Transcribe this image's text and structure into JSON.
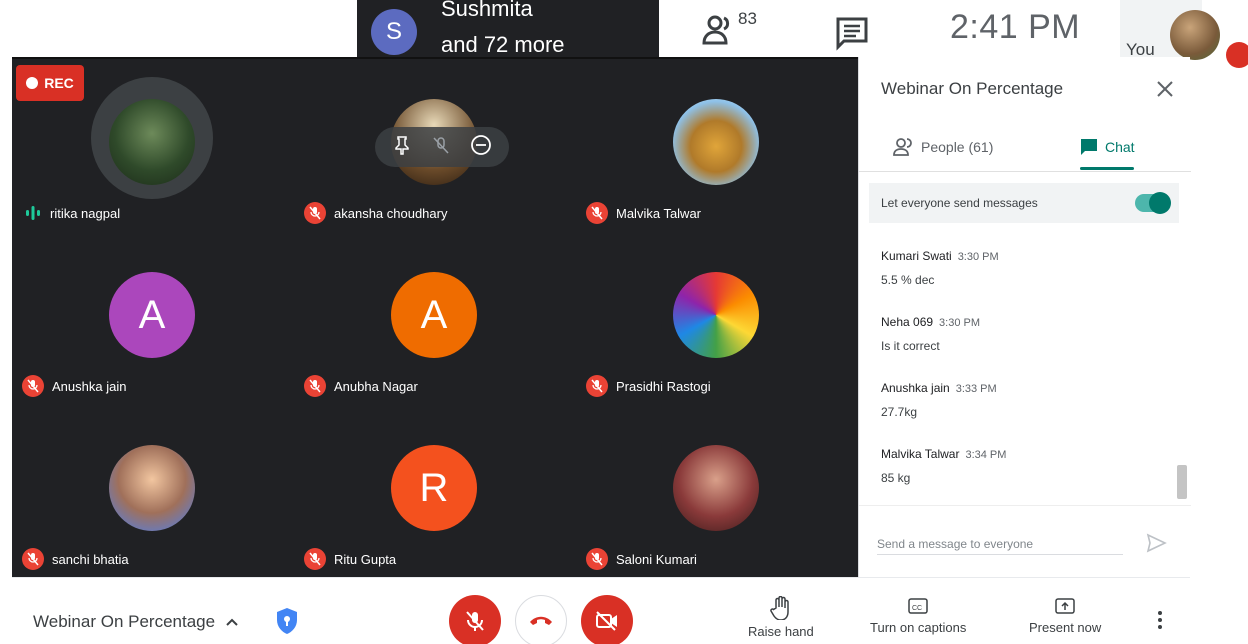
{
  "top": {
    "presenter_initial": "S",
    "presenter_name": "Sushmita",
    "presenter_more": "and 72 more",
    "participants_count": "83",
    "clock": "2:41 PM",
    "self_label": "You"
  },
  "grid": {
    "rec_label": "REC",
    "tiles": [
      {
        "name": "ritika nagpal",
        "muted": false,
        "speaking": true,
        "avatar_type": "photo"
      },
      {
        "name": "akansha choudhary",
        "muted": true,
        "avatar_type": "photo"
      },
      {
        "name": "Malvika Talwar",
        "muted": true,
        "avatar_type": "photo"
      },
      {
        "name": "Anushka jain",
        "muted": true,
        "avatar_type": "initial",
        "initial": "A",
        "color": "#ab47bc"
      },
      {
        "name": "Anubha Nagar",
        "muted": true,
        "avatar_type": "initial",
        "initial": "A",
        "color": "#ef6c00"
      },
      {
        "name": "Prasidhi Rastogi",
        "muted": true,
        "avatar_type": "photo"
      },
      {
        "name": "sanchi bhatia",
        "muted": true,
        "avatar_type": "photo"
      },
      {
        "name": "Ritu Gupta",
        "muted": true,
        "avatar_type": "initial",
        "initial": "R",
        "color": "#f4511e"
      },
      {
        "name": "Saloni Kumari",
        "muted": true,
        "avatar_type": "photo"
      }
    ]
  },
  "panel": {
    "title": "Webinar On Percentage",
    "tab_people": "People (61)",
    "tab_chat": "Chat",
    "toggle_label": "Let everyone send messages",
    "toggle_on": true,
    "messages": [
      {
        "sender": "Kumari Swati",
        "time": "3:30 PM",
        "text": "5.5 % dec"
      },
      {
        "sender": "Neha 069",
        "time": "3:30 PM",
        "text": "Is it correct"
      },
      {
        "sender": "Anushka jain",
        "time": "3:33 PM",
        "text": "27.7kg"
      },
      {
        "sender": "Malvika Talwar",
        "time": "3:34 PM",
        "text": "85 kg"
      }
    ],
    "input_placeholder": "Send a message to everyone"
  },
  "bottom": {
    "meeting_title": "Webinar On Percentage",
    "raise_hand": "Raise hand",
    "captions": "Turn on captions",
    "present": "Present now"
  },
  "colors": {
    "accent": "#00796b",
    "danger": "#d93025",
    "grid_bg": "#202124"
  }
}
